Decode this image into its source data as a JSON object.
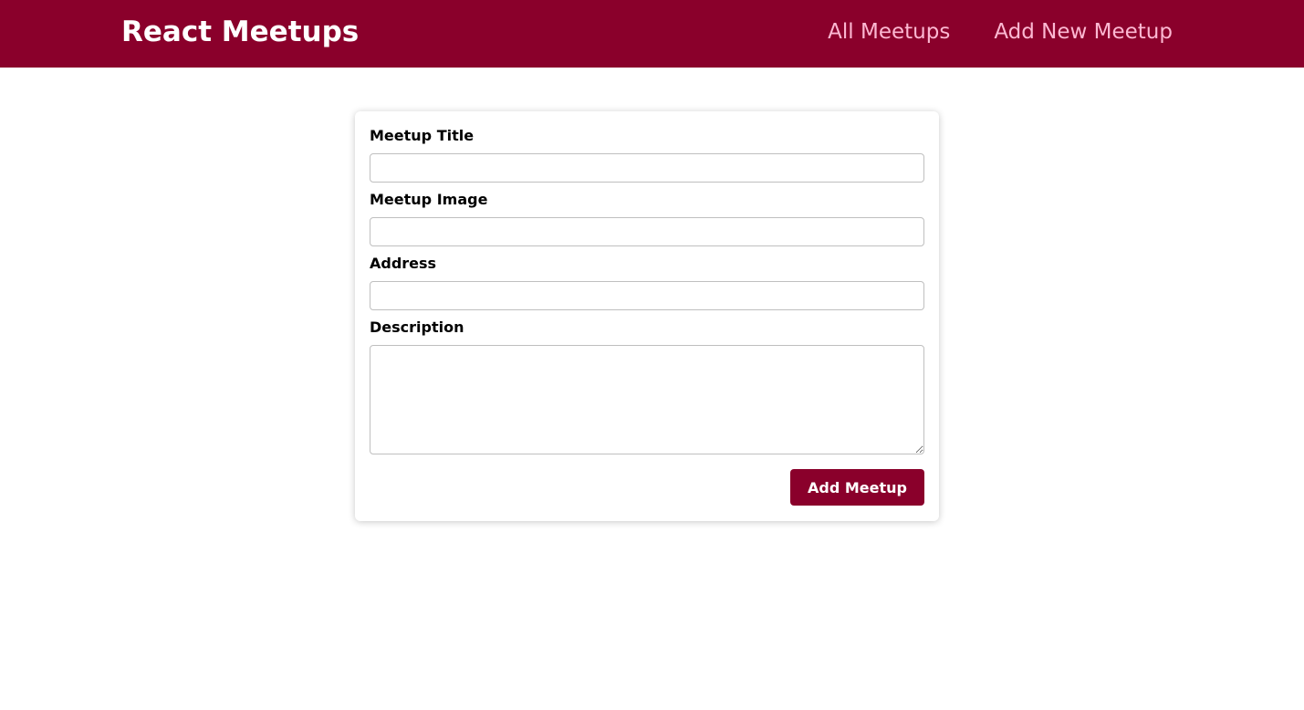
{
  "header": {
    "logo": "React Meetups",
    "nav": [
      {
        "label": "All Meetups"
      },
      {
        "label": "Add New Meetup"
      }
    ]
  },
  "form": {
    "fields": [
      {
        "label": "Meetup Title",
        "value": ""
      },
      {
        "label": "Meetup Image",
        "value": ""
      },
      {
        "label": "Address",
        "value": ""
      },
      {
        "label": "Description",
        "value": ""
      }
    ],
    "submit_label": "Add Meetup"
  },
  "colors": {
    "brand": "#8a002b",
    "nav_link": "#fcb8d2",
    "background": "#ffffff"
  }
}
